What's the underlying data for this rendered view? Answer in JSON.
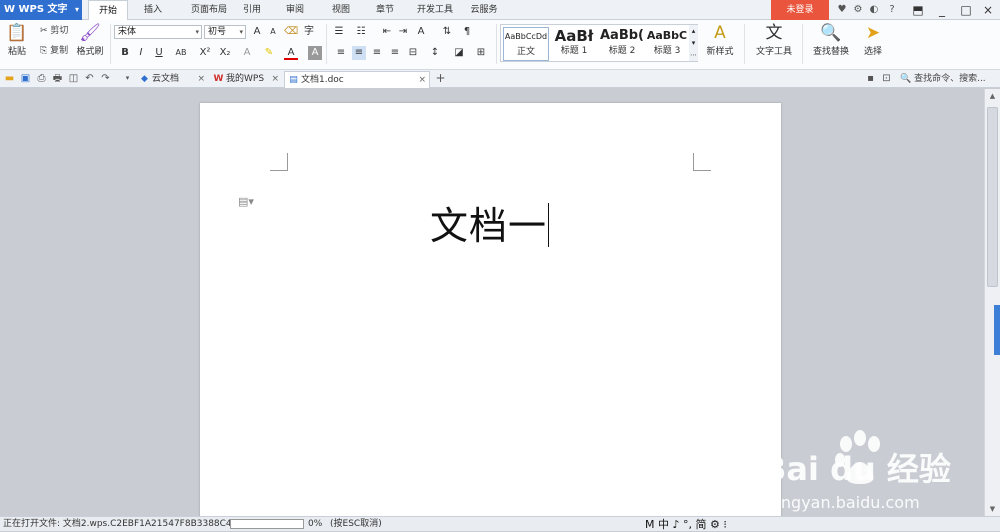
{
  "app": {
    "title": "WPS 文字",
    "login_label": "未登录"
  },
  "menu_tabs": [
    "开始",
    "插入",
    "页面布局",
    "引用",
    "审阅",
    "视图",
    "章节",
    "开发工具",
    "云服务"
  ],
  "clipboard": {
    "paste": "粘贴",
    "cut": "剪切",
    "copy": "复制",
    "format_painter": "格式刷"
  },
  "font": {
    "name": "宋体",
    "size": "初号"
  },
  "styles": [
    {
      "preview": "AaBbCcDd",
      "name": "正文"
    },
    {
      "preview": "AaBł",
      "name": "标题 1"
    },
    {
      "preview": "AaBb(",
      "name": "标题 2"
    },
    {
      "preview": "AaBbC",
      "name": "标题 3"
    }
  ],
  "ribbon_buttons": {
    "new_style": "新样式",
    "text_tools": "文字工具",
    "find_replace": "查找替换",
    "select": "选择"
  },
  "doc_tabs": [
    {
      "label": "云文档"
    },
    {
      "label": "我的WPS"
    },
    {
      "label": "文档1.doc"
    }
  ],
  "search": {
    "placeholder": "查找命令、搜索..."
  },
  "document": {
    "heading": "文档一"
  },
  "status": {
    "opening": "正在打开文件: 文档2.wps.C2EBF1A21547F8B3388C42...",
    "progress": 0.0,
    "percent": "0%",
    "hint": "(按ESC取消)",
    "ime": "M 中 ♪ °, 简 ⚙ ⁝"
  },
  "watermark": {
    "brand": "Bai du 经验",
    "url": "jingyan.baidu.com"
  },
  "colors": {
    "accent": "#2e6fd0",
    "login": "#e9553d",
    "workspace": "#c9ccd3"
  }
}
